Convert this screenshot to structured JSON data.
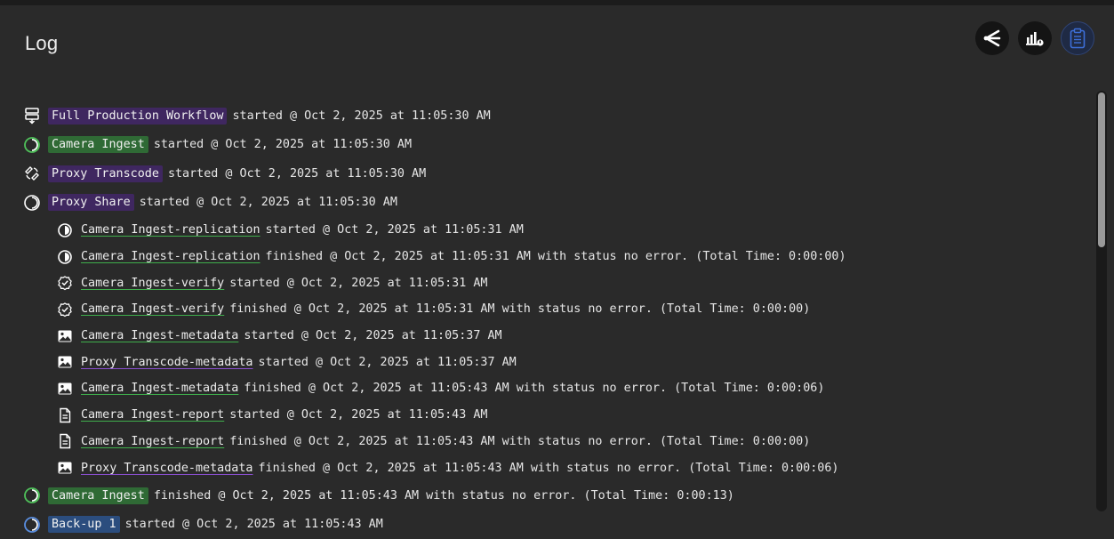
{
  "title": "Log",
  "toolbar": {
    "buttons": [
      {
        "icon": "workflow-branch-icon",
        "active": false
      },
      {
        "icon": "stats-chart-icon",
        "active": false
      },
      {
        "icon": "clipboard-icon",
        "active": true
      }
    ]
  },
  "colors": {
    "background": "#2a2a2a",
    "tag_purple": "#3f2760",
    "tag_green": "#2f6a35",
    "tag_blue": "#2b4d7e",
    "underline_green": "#3fae4c",
    "underline_purple": "#8a4fd0"
  },
  "log": {
    "entries": [
      {
        "icon": "workflow-icon",
        "name": "Full Production Workflow",
        "style": "tag-purple",
        "message": "started @ Oct 2, 2025 at 11:05:30 AM"
      },
      {
        "icon": "ingest-circle-icon",
        "name": "Camera Ingest",
        "style": "tag-green",
        "message": "started @ Oct 2, 2025 at 11:05:30 AM"
      },
      {
        "icon": "transcode-icon",
        "name": "Proxy Transcode",
        "style": "tag-purple",
        "message": "started @ Oct 2, 2025 at 11:05:30 AM"
      },
      {
        "icon": "share-circle-icon",
        "name": "Proxy Share",
        "style": "tag-purple",
        "message": "started @ Oct 2, 2025 at 11:05:30 AM"
      },
      {
        "icon": "replication-icon",
        "name": "Camera Ingest-replication",
        "style": "link-green",
        "message": "started @ Oct 2, 2025 at 11:05:31 AM"
      },
      {
        "icon": "replication-icon",
        "name": "Camera Ingest-replication",
        "style": "link-green",
        "message": "finished @ Oct 2, 2025 at 11:05:31 AM with status no error. (Total Time: 0:00:00)"
      },
      {
        "icon": "verify-check-icon",
        "name": "Camera Ingest-verify",
        "style": "link-green",
        "message": "started @ Oct 2, 2025 at 11:05:31 AM"
      },
      {
        "icon": "verify-check-icon",
        "name": "Camera Ingest-verify",
        "style": "link-green",
        "message": "finished @ Oct 2, 2025 at 11:05:31 AM with status no error. (Total Time: 0:00:00)"
      },
      {
        "icon": "image-metadata-icon",
        "name": "Camera Ingest-metadata",
        "style": "link-green",
        "message": "started @ Oct 2, 2025 at 11:05:37 AM"
      },
      {
        "icon": "image-metadata-icon",
        "name": "Proxy Transcode-metadata",
        "style": "link-purple",
        "message": "started @ Oct 2, 2025 at 11:05:37 AM"
      },
      {
        "icon": "image-metadata-icon",
        "name": "Camera Ingest-metadata",
        "style": "link-green",
        "message": "finished @ Oct 2, 2025 at 11:05:43 AM with status no error. (Total Time: 0:00:06)"
      },
      {
        "icon": "report-document-icon",
        "name": "Camera Ingest-report",
        "style": "link-green",
        "message": "started @ Oct 2, 2025 at 11:05:43 AM"
      },
      {
        "icon": "report-document-icon",
        "name": "Camera Ingest-report",
        "style": "link-green",
        "message": "finished @ Oct 2, 2025 at 11:05:43 AM with status no error. (Total Time: 0:00:00)"
      },
      {
        "icon": "image-metadata-icon",
        "name": "Proxy Transcode-metadata",
        "style": "link-purple",
        "message": "finished @ Oct 2, 2025 at 11:05:43 AM with status no error. (Total Time: 0:00:06)"
      },
      {
        "icon": "ingest-circle-icon",
        "name": "Camera Ingest",
        "style": "tag-green",
        "message": "finished @ Oct 2, 2025 at 11:05:43 AM with status no error. (Total Time: 0:00:13)"
      },
      {
        "icon": "backup-circle-icon",
        "name": "Back-up 1",
        "style": "tag-blue",
        "message": "started @ Oct 2, 2025 at 11:05:43 AM"
      }
    ]
  }
}
